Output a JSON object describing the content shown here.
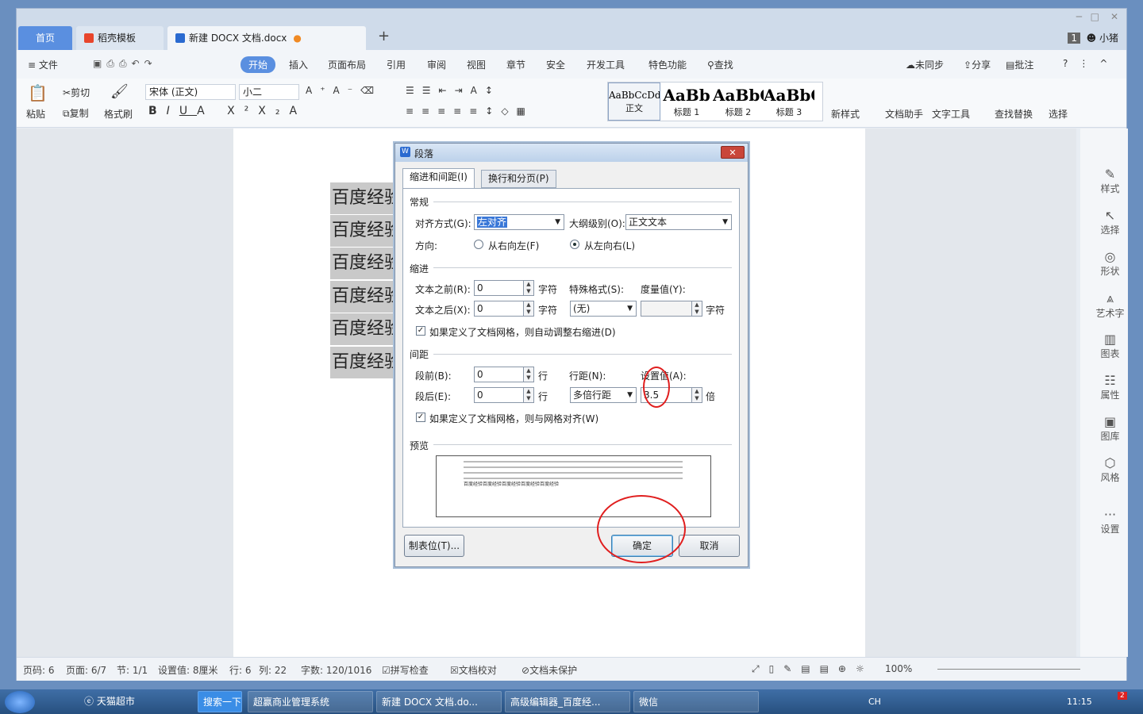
{
  "tabs": {
    "home": "首页",
    "template": "稻壳模板",
    "doc": "新建 DOCX 文档.docx"
  },
  "window_badge": "1",
  "user": "小猪",
  "menu": {
    "file": "文件",
    "items": [
      "开始",
      "插入",
      "页面布局",
      "引用",
      "审阅",
      "视图",
      "章节",
      "安全",
      "开发工具",
      "特色功能"
    ],
    "search": "查找",
    "sync": "未同步",
    "share": "分享",
    "annotate": "批注"
  },
  "ribbon": {
    "paste": "粘贴",
    "cut": "剪切",
    "copy": "复制",
    "format_painter": "格式刷",
    "font_name": "宋体 (正文)",
    "font_size": "小二",
    "styles": [
      {
        "sample": "AaBbCcDd",
        "name": "正文"
      },
      {
        "sample": "AaBb",
        "name": "标题 1"
      },
      {
        "sample": "AaBbC",
        "name": "标题 2"
      },
      {
        "sample": "AaBbC",
        "name": "标题 3"
      }
    ],
    "new_style": "新样式",
    "doc_helper": "文档助手",
    "text_tools": "文字工具",
    "find_replace": "查找替换",
    "select": "选择"
  },
  "doc_lines": [
    "百度经验",
    "百度经验",
    "百度经验",
    "百度经验",
    "百度经验",
    "百度经验"
  ],
  "dialog": {
    "title": "段落",
    "tab1": "缩进和间距(I)",
    "tab2": "换行和分页(P)",
    "general": "常规",
    "align_label": "对齐方式(G):",
    "align_value": "左对齐",
    "outline_label": "大纲级别(O):",
    "outline_value": "正文文本",
    "direction_label": "方向:",
    "rtl": "从右向左(F)",
    "ltr": "从左向右(L)",
    "indent": "缩进",
    "before_text_label": "文本之前(R):",
    "before_text_value": "0",
    "unit_char": "字符",
    "special_label": "特殊格式(S):",
    "measure_label": "度量值(Y):",
    "after_text_label": "文本之后(X):",
    "after_text_value": "0",
    "special_value": "(无)",
    "grid_indent": "如果定义了文档网格，则自动调整右缩进(D)",
    "spacing": "间距",
    "space_before_label": "段前(B):",
    "space_before_value": "0",
    "unit_line": "行",
    "line_spacing_label": "行距(N):",
    "setting_label": "设置值(A):",
    "space_after_label": "段后(E):",
    "space_after_value": "0",
    "line_spacing_value": "多倍行距",
    "setting_value": "3.5",
    "unit_times": "倍",
    "grid_align": "如果定义了文档网格，则与网格对齐(W)",
    "preview": "预览",
    "preview_text": "百度经验百度经验百度经验百度经验百度经验",
    "tabs_button": "制表位(T)...",
    "ok": "确定",
    "cancel": "取消"
  },
  "sidebar": [
    "样式",
    "选择",
    "形状",
    "艺术字",
    "图表",
    "属性",
    "图库",
    "风格",
    "设置"
  ],
  "status": {
    "page_code": "页码: 6",
    "page": "页面: 6/7",
    "section": "节: 1/1",
    "setting": "设置值: 8厘米",
    "row": "行: 6",
    "col": "列: 22",
    "words": "字数: 120/1016",
    "spell": "拼写检查",
    "proof": "文档校对",
    "protect": "文档未保护",
    "zoom": "100%"
  },
  "taskbar": {
    "ie": "天猫超市",
    "search": "搜索一下",
    "t1": "超赢商业管理系统",
    "t2": "新建 DOCX 文档.do...",
    "t3": "高级编辑器_百度经...",
    "t4": "微信",
    "lang": "CH",
    "time": "11:15",
    "badge": "2"
  }
}
